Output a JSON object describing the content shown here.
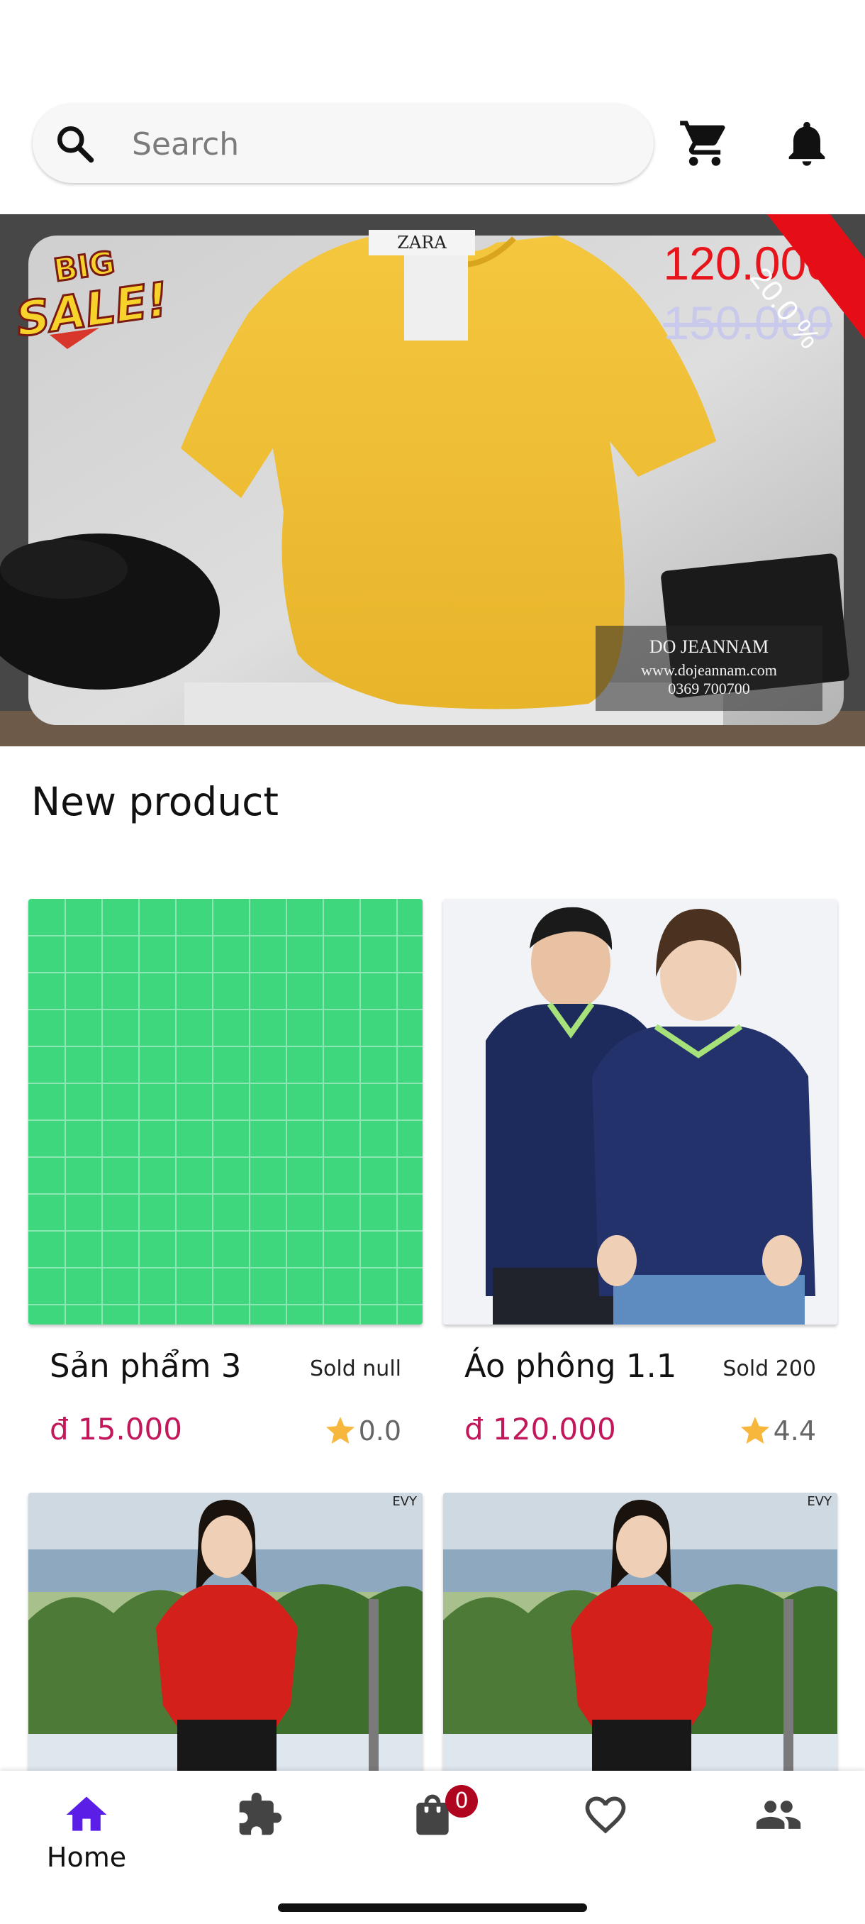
{
  "search": {
    "placeholder": "Search",
    "icon": "search-icon"
  },
  "header_icons": [
    "cart-icon",
    "bell-icon"
  ],
  "banner": {
    "sale_label_1": "BIG",
    "sale_label_2": "SALE!",
    "discount": "20.0 %",
    "price_new": "120.000",
    "price_old": "150.000",
    "photo_brand": "DO JEANNAM",
    "photo_website": "www.dojeannam.com",
    "photo_phone": "0369 700700",
    "shirt_tag": "ZARA",
    "colors": {
      "price_new": "#e8141c",
      "discount_ribbon": "#e50e16",
      "shirt": "#f2c23a"
    }
  },
  "section": {
    "title": "New product"
  },
  "products": [
    {
      "name": "Sản  phẩm 3",
      "sold": "Sold null",
      "price": "đ 15.000",
      "rating": "0.0"
    },
    {
      "name": "Áo phông 1.1",
      "sold": "Sold 200",
      "price": "đ 120.000",
      "rating": "4.4"
    },
    {
      "name": "",
      "sold": "",
      "price": "",
      "rating": ""
    },
    {
      "name": "",
      "sold": "",
      "price": "",
      "rating": ""
    }
  ],
  "product_photo_watermark": "EVY",
  "bottom_nav": {
    "items": [
      {
        "label": "Home",
        "icon": "home-icon",
        "active": true
      },
      {
        "label": "",
        "icon": "puzzle-icon",
        "active": false
      },
      {
        "label": "",
        "icon": "shopping-bag-icon",
        "active": false
      },
      {
        "label": "",
        "icon": "heart-icon",
        "active": false
      },
      {
        "label": "",
        "icon": "people-icon",
        "active": false
      }
    ],
    "bag_badge": "0"
  },
  "colors": {
    "accent_active": "#5b1ee6",
    "price": "#c2185b",
    "star": "#f6b73c",
    "badge": "#b0051f"
  }
}
